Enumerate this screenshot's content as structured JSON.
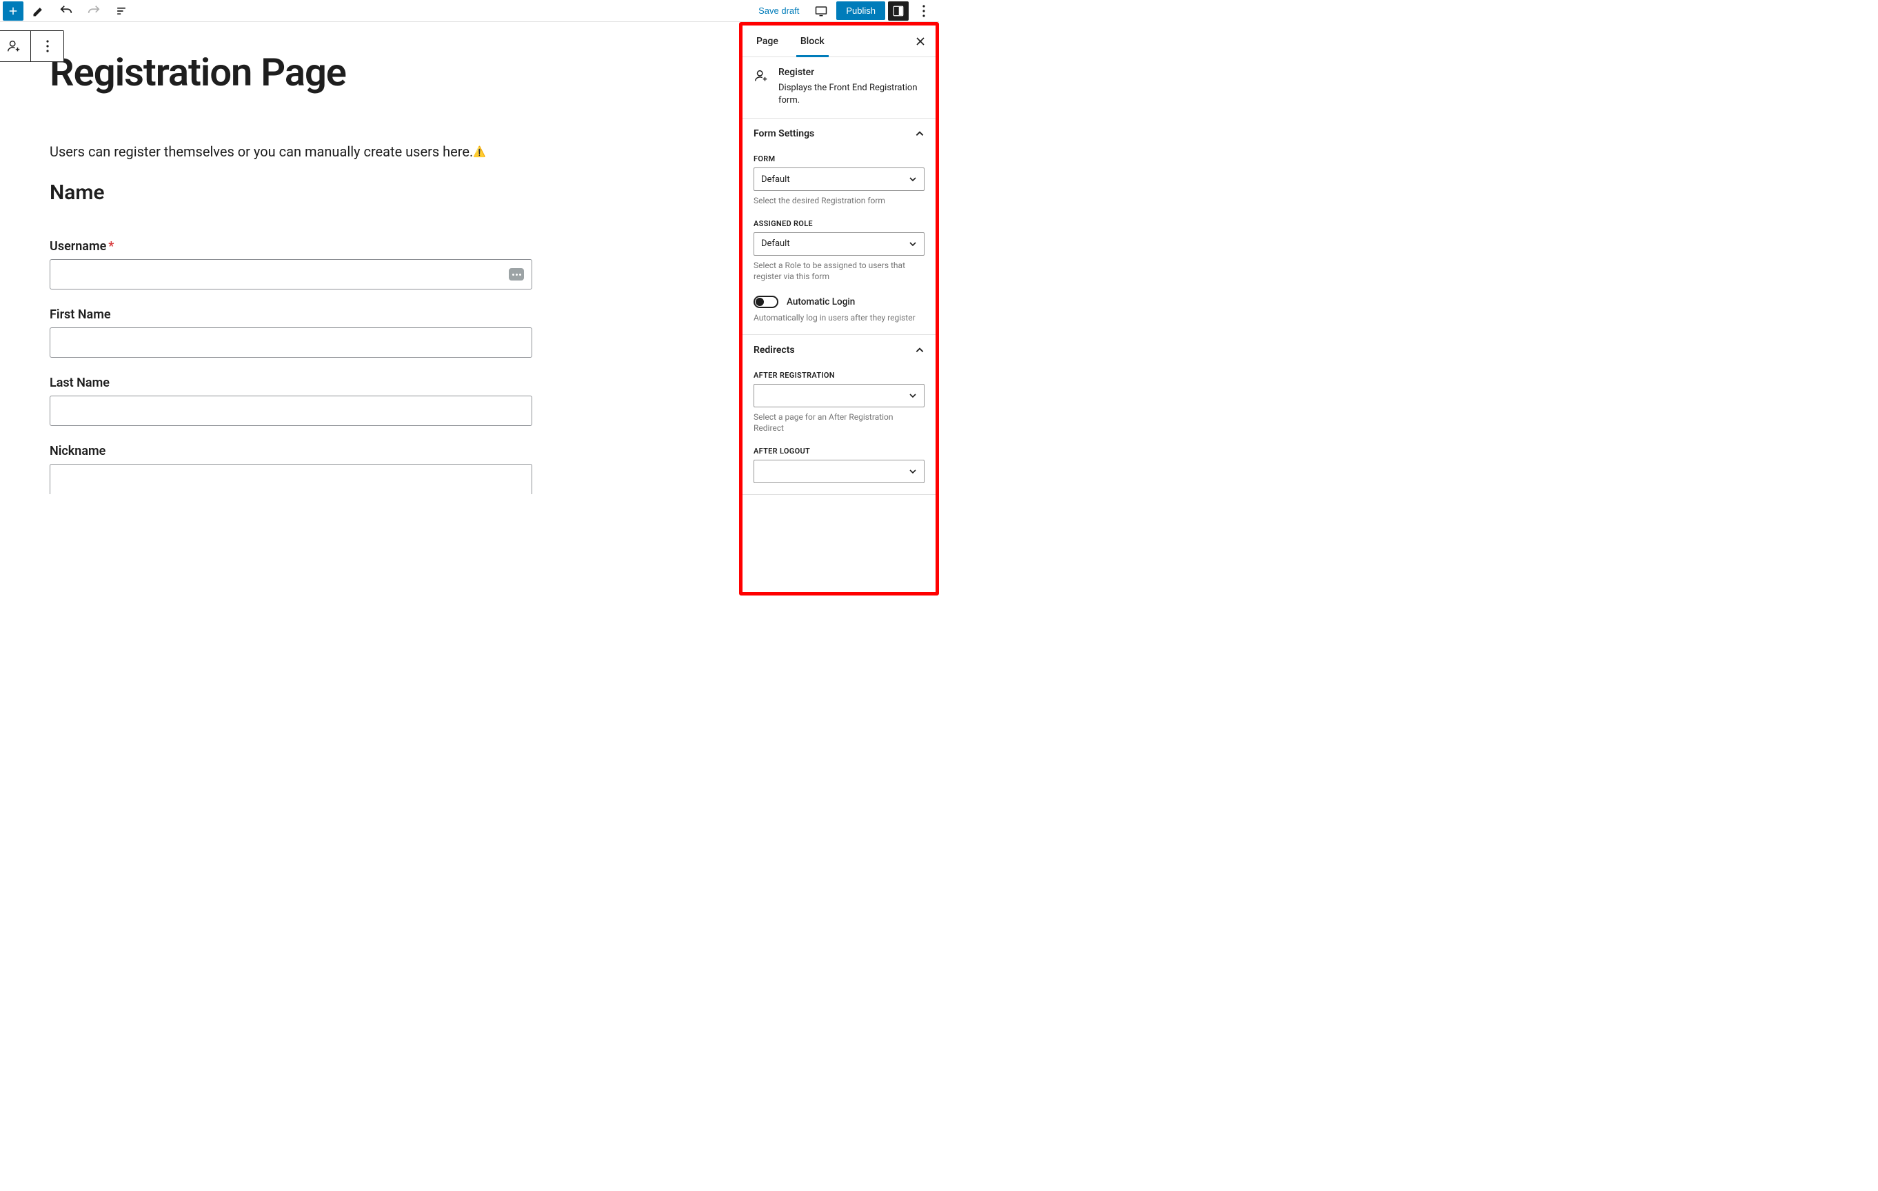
{
  "topbar": {
    "save_draft": "Save draft",
    "publish": "Publish"
  },
  "page": {
    "title": "Registration Page",
    "intro_text": "Users can register themselves or you can manually create users here.",
    "section_name": "Name",
    "fields": {
      "username_label": "Username",
      "first_name_label": "First Name",
      "last_name_label": "Last Name",
      "nickname_label": "Nickname"
    }
  },
  "sidebar": {
    "tabs": {
      "page": "Page",
      "block": "Block"
    },
    "block_info": {
      "title": "Register",
      "desc": "Displays the Front End Registration form."
    },
    "form_settings": {
      "heading": "Form Settings",
      "form_label": "FORM",
      "form_value": "Default",
      "form_help": "Select the desired Registration form",
      "role_label": "ASSIGNED ROLE",
      "role_value": "Default",
      "role_help": "Select a Role to be assigned to users that register via this form",
      "auto_login_label": "Automatic Login",
      "auto_login_help": "Automatically log in users after they register"
    },
    "redirects": {
      "heading": "Redirects",
      "after_reg_label": "AFTER REGISTRATION",
      "after_reg_value": "",
      "after_reg_help": "Select a page for an After Registration Redirect",
      "after_logout_label": "AFTER LOGOUT"
    }
  }
}
